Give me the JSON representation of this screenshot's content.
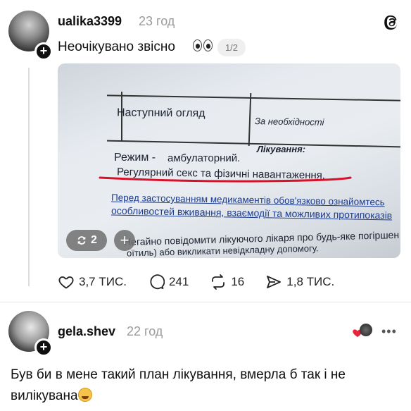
{
  "post": {
    "username": "ualika3399",
    "time": "23 год",
    "text": "Неочікувано звісно",
    "page_indicator": "1/2",
    "photo": {
      "header_left": "Наступний огляд",
      "header_right": "За необхідності",
      "section_title": "Лікування:",
      "regime_label": "Режим -",
      "regime_value": "амбулаторний.",
      "underlined_line": "Регулярний секс та фізичні навантаження.",
      "warning_line_1": "Перед застосуванням медикаментів обов'язково ознайомтесь",
      "warning_line_2": "особливостей вживання, взаємодії та можливих протипоказів",
      "notice_line_1": "Негайно повідомити лікуючого лікаря про будь-яке погіршен",
      "notice_line_2": "оїтиль) або викликати невідкладну допомогу.",
      "repost_count": "2"
    },
    "actions": {
      "likes": "3,7 ТИС.",
      "comments": "241",
      "reposts": "16",
      "shares": "1,8 ТИС."
    }
  },
  "reply": {
    "username": "gela.shev",
    "time": "22 год",
    "text": "Був би в мене такий план лікування, вмерла б так і не вилікувана"
  },
  "colors": {
    "accent_red": "#e8243a",
    "underline_red": "#d8102a",
    "text_primary": "#101010",
    "text_secondary": "#9a9a9a"
  }
}
